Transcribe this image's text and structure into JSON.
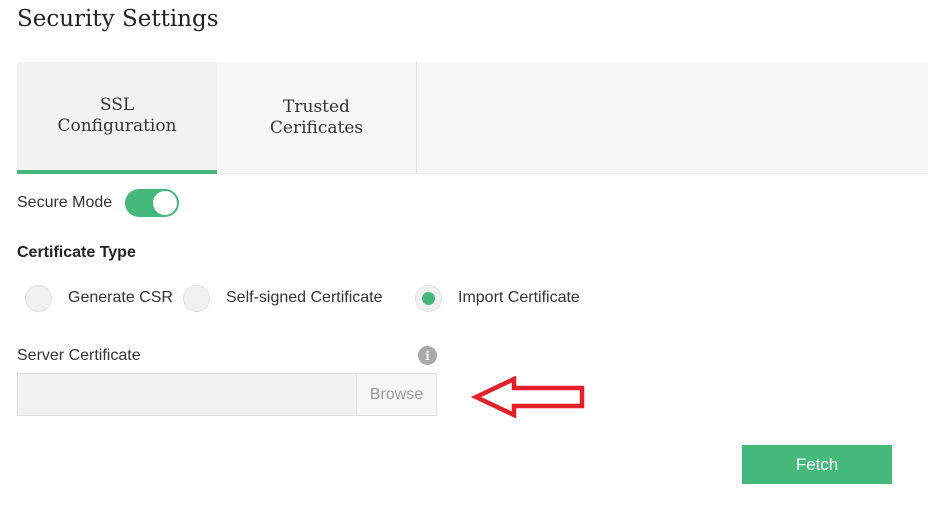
{
  "page": {
    "title": "Security Settings"
  },
  "tabs": [
    {
      "label": "SSL\nConfiguration",
      "active": true
    },
    {
      "label": "Trusted\nCerificates",
      "active": false
    }
  ],
  "secure_mode": {
    "label": "Secure Mode",
    "enabled": true
  },
  "certificate_type": {
    "label": "Certificate Type",
    "options": [
      {
        "label": "Generate CSR",
        "selected": false
      },
      {
        "label": "Self-signed Certificate",
        "selected": false
      },
      {
        "label": "Import Certificate",
        "selected": true
      }
    ]
  },
  "server_certificate": {
    "label": "Server Certificate",
    "value": "",
    "browse_label": "Browse",
    "info_icon": "info-icon"
  },
  "actions": {
    "fetch_label": "Fetch"
  },
  "colors": {
    "accent": "#45b97c",
    "annotation_arrow": "#e4202a"
  }
}
